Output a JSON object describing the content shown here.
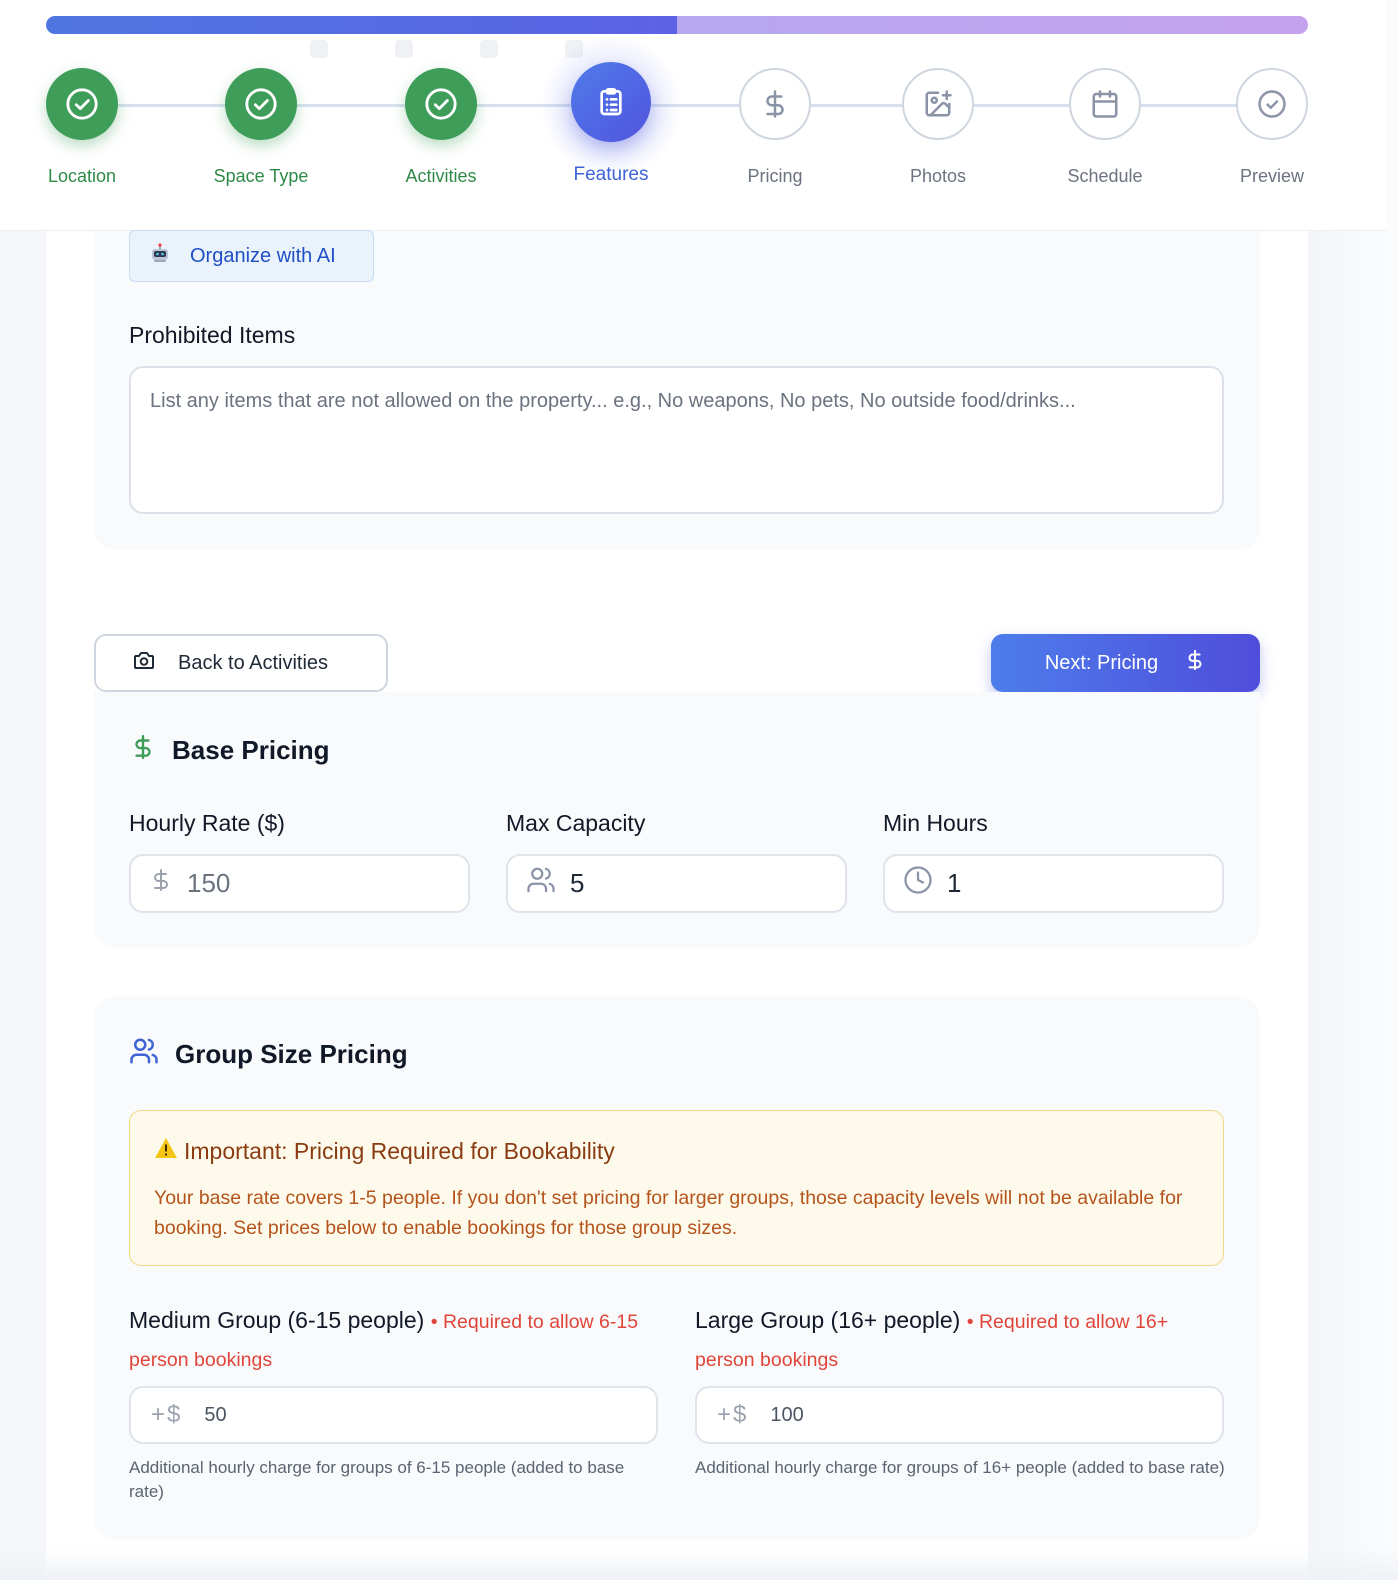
{
  "progress": {
    "fraction": 0.5
  },
  "steps": [
    {
      "label": "Location",
      "status": "done",
      "icon": "check-circle-icon"
    },
    {
      "label": "Space Type",
      "status": "done",
      "icon": "check-circle-icon"
    },
    {
      "label": "Activities",
      "status": "done",
      "icon": "check-circle-icon"
    },
    {
      "label": "Features",
      "status": "active",
      "icon": "clipboard-icon"
    },
    {
      "label": "Pricing",
      "status": "pending",
      "icon": "dollar-icon"
    },
    {
      "label": "Photos",
      "status": "pending",
      "icon": "image-plus-icon"
    },
    {
      "label": "Schedule",
      "status": "pending",
      "icon": "calendar-icon"
    },
    {
      "label": "Preview",
      "status": "pending",
      "icon": "check-circle-icon"
    }
  ],
  "features": {
    "ai_button_label": "Organize with AI",
    "prohibited_label": "Prohibited Items",
    "prohibited_placeholder": "List any items that are not allowed on the property... e.g., No weapons, No pets, No outside food/drinks..."
  },
  "nav": {
    "back_label": "Back to Activities",
    "next_label": "Next: Pricing"
  },
  "base_pricing": {
    "title": "Base Pricing",
    "hourly_rate_label": "Hourly Rate ($)",
    "hourly_rate_value": "150",
    "max_capacity_label": "Max Capacity",
    "max_capacity_value": "5",
    "min_hours_label": "Min Hours",
    "min_hours_value": "1"
  },
  "group_pricing": {
    "title": "Group Size Pricing",
    "warning_title": "Important: Pricing Required for Bookability",
    "warning_body": "Your base rate covers 1-5 people. If you don't set pricing for larger groups, those capacity levels will not be available for booking. Set prices below to enable bookings for those group sizes.",
    "medium_label": "Medium Group (6-15 people)",
    "medium_required": "• Required to allow 6-15 person bookings",
    "medium_prefix": "+$",
    "medium_value": "50",
    "medium_helper": "Additional hourly charge for groups of 6-15 people (added to base rate)",
    "large_label": "Large Group (16+ people)",
    "large_required": "• Required to allow 16+ person bookings",
    "large_prefix": "+$",
    "large_value": "100",
    "large_helper": "Additional hourly charge for groups of 16+ people (added to base rate)"
  },
  "colors": {
    "done": "#3f9d5a",
    "active": "#4f66e4",
    "warning_bg": "#fefaeb",
    "required_text": "#e0453a"
  }
}
